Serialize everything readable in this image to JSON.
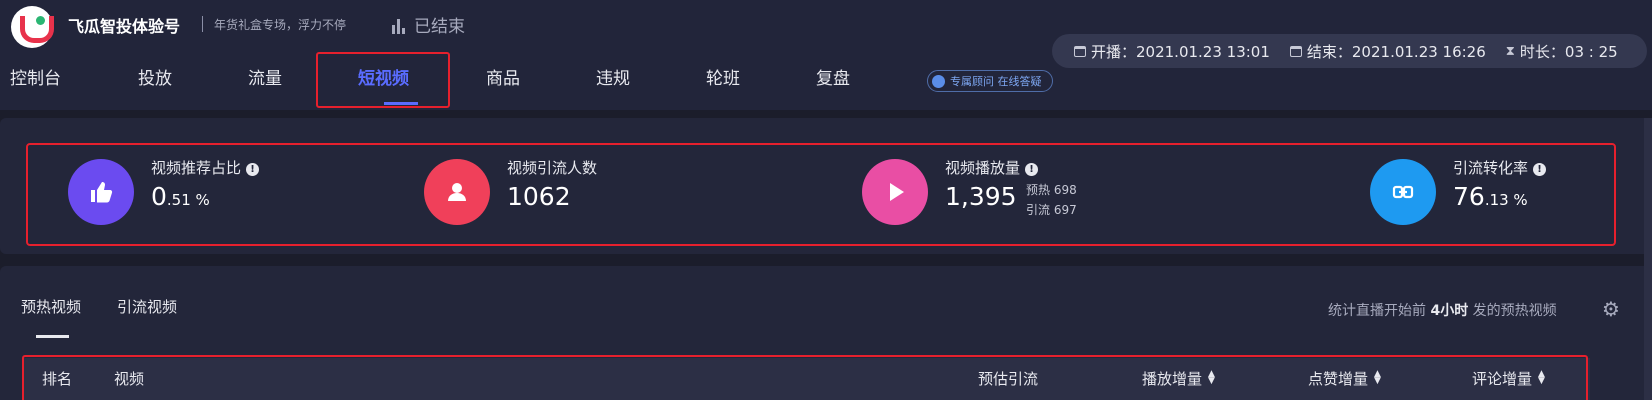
{
  "header": {
    "brand": "飞瓜智投体验号",
    "subtitle": "年货礼盒专场，浮力不停",
    "status": "已结束",
    "time": {
      "start": "开播：2021.01.23 13:01",
      "end": "结束：2021.01.23 16:26",
      "duration": "时长：03 : 25"
    },
    "consult": "专属顾问 在线答疑"
  },
  "nav": {
    "items": [
      "控制台",
      "投放",
      "流量",
      "短视频",
      "商品",
      "违规",
      "轮班",
      "复盘"
    ],
    "active": "短视频"
  },
  "metrics": [
    {
      "label": "视频推荐占比",
      "value": "0",
      "value_suffix": ".51 %",
      "color": "#6b4bf0",
      "icon": "thumbs-up-icon"
    },
    {
      "label": "视频引流人数",
      "value": "1062",
      "value_suffix": "",
      "color": "#f0405a",
      "icon": "user-icon"
    },
    {
      "label": "视频播放量",
      "value": "1,395",
      "value_suffix": "",
      "sub1": "预热 698",
      "sub2": "引流 697",
      "color": "#e94ea4",
      "icon": "play-icon"
    },
    {
      "label": "引流转化率",
      "value": "76",
      "value_suffix": ".13 %",
      "color": "#1e9af1",
      "icon": "conversion-icon"
    }
  ],
  "tabs": [
    "预热视频",
    "引流视频"
  ],
  "stat_note": {
    "prefix": "统计直播开始前",
    "bold": "4小时",
    "suffix": "发的预热视频"
  },
  "table": {
    "headers": [
      "排名",
      "视频",
      "预估引流",
      "播放增量",
      "点赞增量",
      "评论增量"
    ]
  }
}
